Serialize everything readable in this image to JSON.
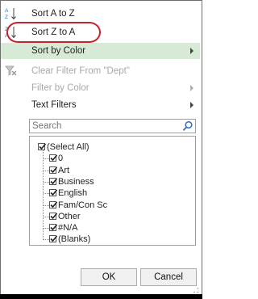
{
  "menu": {
    "sort_a_to_z": "Sort A to Z",
    "sort_z_to_a": "Sort Z to A",
    "sort_by_color": "Sort by Color",
    "clear_filter": "Clear Filter From \"Dept\"",
    "filter_by_color": "Filter by Color",
    "text_filters": "Text Filters"
  },
  "search": {
    "placeholder": "Search"
  },
  "filter_values": [
    {
      "label": "(Select All)",
      "checked": true
    },
    {
      "label": "0",
      "checked": true
    },
    {
      "label": "Art",
      "checked": true
    },
    {
      "label": "Business",
      "checked": true
    },
    {
      "label": "English",
      "checked": true
    },
    {
      "label": "Fam/Con Sc",
      "checked": true
    },
    {
      "label": "Other",
      "checked": true
    },
    {
      "label": "#N/A",
      "checked": true
    },
    {
      "label": "(Blanks)",
      "checked": true
    }
  ],
  "buttons": {
    "ok": "OK",
    "cancel": "Cancel"
  },
  "colors": {
    "hover_highlight": "#d6ead6",
    "annotation_circle": "#c0272d",
    "sort_icon_blue": "#2e6fbf"
  }
}
